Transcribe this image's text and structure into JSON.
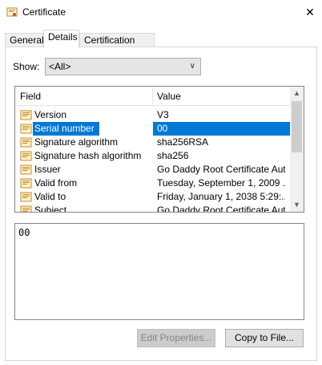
{
  "window": {
    "title": "Certificate",
    "close_glyph": "✕"
  },
  "tabs": [
    {
      "label": "General"
    },
    {
      "label": "Details"
    },
    {
      "label": "Certification Path"
    }
  ],
  "show": {
    "label": "Show:",
    "value": "<All>",
    "chevron": "∨"
  },
  "list": {
    "columns": {
      "field": "Field",
      "value": "Value"
    },
    "rows": [
      {
        "field": "Version",
        "value": "V3"
      },
      {
        "field": "Serial number",
        "value": "00"
      },
      {
        "field": "Signature algorithm",
        "value": "sha256RSA"
      },
      {
        "field": "Signature hash algorithm",
        "value": "sha256"
      },
      {
        "field": "Issuer",
        "value": "Go Daddy Root Certificate Aut..."
      },
      {
        "field": "Valid from",
        "value": "Tuesday, September 1, 2009 ..."
      },
      {
        "field": "Valid to",
        "value": "Friday, January 1, 2038 5:29:..."
      },
      {
        "field": "Subject",
        "value": "Go Daddy Root Certificate Aut..."
      }
    ],
    "selected_index": 1,
    "scroll_up": "▲",
    "scroll_down": "▼"
  },
  "detail": {
    "text": "00"
  },
  "buttons": {
    "edit_properties": "Edit Properties...",
    "copy_to_file": "Copy to File..."
  },
  "icons": {
    "title": "certificate-icon",
    "row": "certificate-field-icon"
  }
}
